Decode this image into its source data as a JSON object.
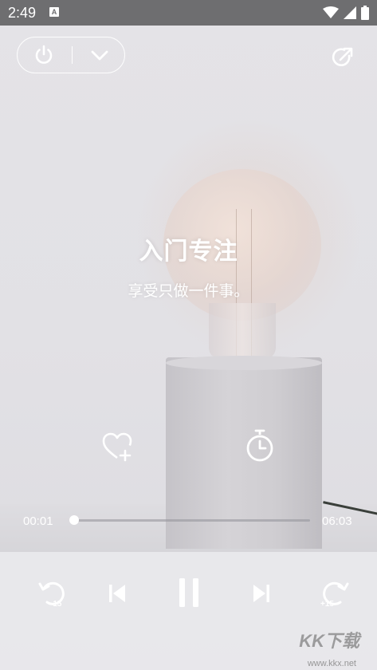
{
  "status_bar": {
    "time": "2:49",
    "notification_letter": "A",
    "icons": [
      "wifi-icon",
      "signal-icon",
      "battery-icon"
    ]
  },
  "top_controls": {
    "icons": [
      "power-icon",
      "chevron-down-icon",
      "share-icon"
    ]
  },
  "content": {
    "title": "入门专注",
    "subtitle": "享受只做一件事。"
  },
  "actions": {
    "icons": [
      "heart-plus-icon",
      "timer-icon"
    ]
  },
  "progress": {
    "current_time": "00:01",
    "total_time": "06:03",
    "fraction": 0.003
  },
  "playback": {
    "rewind_label": "-15",
    "forward_label": "+15",
    "icons": [
      "rewind-15-icon",
      "skip-previous-icon",
      "pause-icon",
      "skip-next-icon",
      "forward-15-icon"
    ]
  },
  "watermark": {
    "text": "KK下载",
    "url": "www.kkx.net"
  },
  "colors": {
    "status_bar": "#6e6e70",
    "foreground": "#ffffff"
  }
}
